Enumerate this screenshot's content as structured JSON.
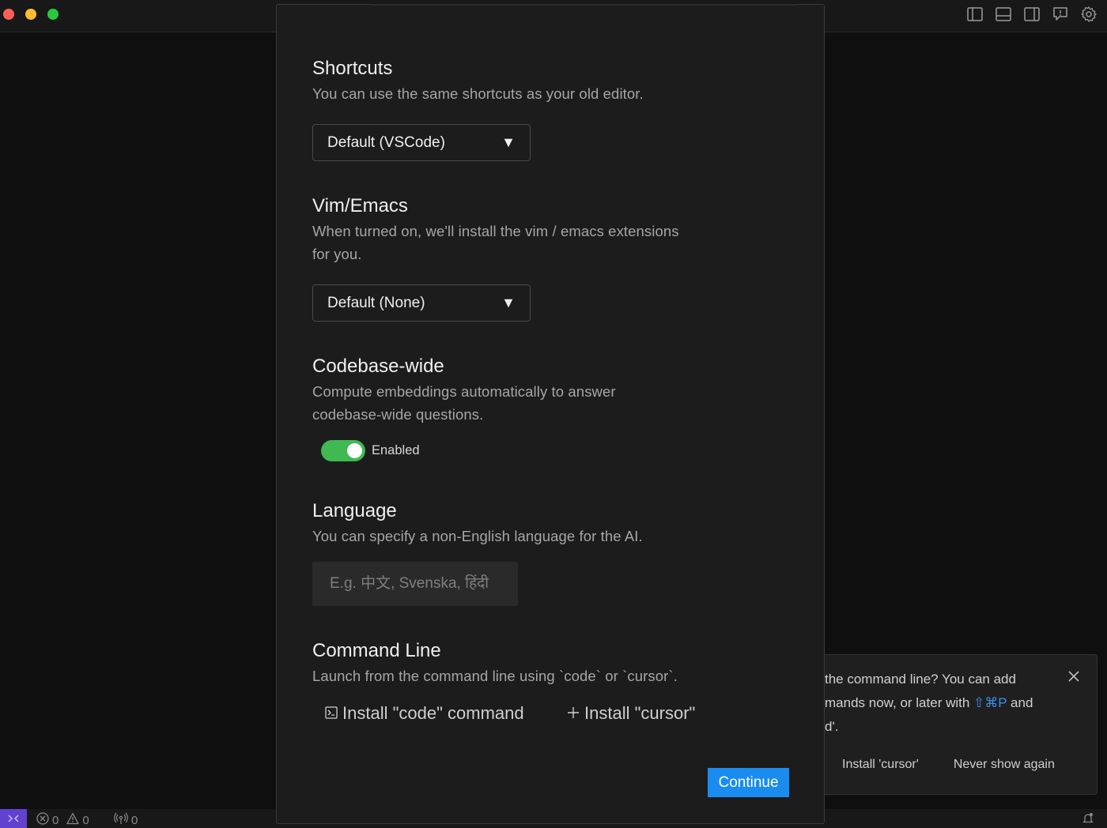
{
  "notification": {
    "text": "the command line? You can add\nmands now, or later with",
    "shortcut": "⇧⌘P",
    "text_after": " and",
    "text_tail": "d'.",
    "action_install": "Install 'cursor'",
    "action_never": "Never show again"
  },
  "statusbar": {
    "errors": "0",
    "warnings": "0",
    "ports": "0"
  },
  "modal": {
    "shortcuts": {
      "title": "Shortcuts",
      "description": "You can use the same shortcuts as your old editor.",
      "selected": "Default (VSCode)"
    },
    "vim": {
      "title": "Vim/Emacs",
      "description_line1": "When turned on, we'll install the vim / emacs extensions",
      "description_line2": "for you.",
      "selected": "Default (None)"
    },
    "codebase": {
      "title": "Codebase-wide",
      "description_line1": "Compute embeddings automatically to answer",
      "description_line2": "codebase-wide questions.",
      "toggle_label": "Enabled",
      "enabled": true
    },
    "language": {
      "title": "Language",
      "description": "You can specify a non-English language for the AI.",
      "placeholder": "E.g. 中文, Svenska, हिंदी",
      "value": ""
    },
    "command_line": {
      "title": "Command Line",
      "description": "Launch from the command line using `code` or `cursor`.",
      "install_code": "Install \"code\" command",
      "install_cursor": "Install \"cursor\""
    },
    "continue_label": "Continue"
  },
  "colors": {
    "accent": "#1a8cf0",
    "toggle_on": "#3fb950",
    "remote": "#6241d1"
  }
}
